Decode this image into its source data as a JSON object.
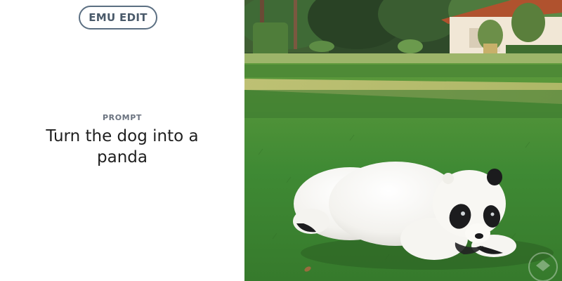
{
  "badge": {
    "label": "EMU EDIT"
  },
  "prompt": {
    "label": "PROMPT",
    "text": "Turn the dog into a panda"
  },
  "image": {
    "subject": "panda-on-lawn"
  }
}
